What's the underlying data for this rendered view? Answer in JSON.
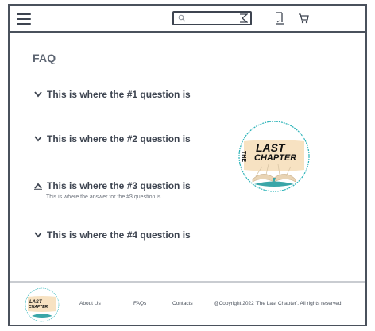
{
  "header": {
    "search": {
      "placeholder": ""
    },
    "icons": {
      "menu": "menu-icon",
      "search": "search-icon",
      "submit": "search-submit-icon",
      "account": "account-icon",
      "cart": "cart-icon"
    }
  },
  "main": {
    "title": "FAQ",
    "faqs": [
      {
        "question": "This is where the #1 question is",
        "expanded": false
      },
      {
        "question": "This is where the #2 question is",
        "expanded": false
      },
      {
        "question": "This is where the #3 question is",
        "answer": "This is where the answer for the #3 question is.",
        "expanded": true
      },
      {
        "question": "This is where the #4 question is",
        "expanded": false
      }
    ],
    "logo": {
      "line1": "THE",
      "line2": "LAST",
      "line3": "CHAPTER",
      "colors": {
        "bg": "#f7e2c2",
        "ring": "#2bb3b8",
        "ink": "#111111",
        "book": "#3aa6a8"
      }
    }
  },
  "footer": {
    "links": [
      "About Us",
      "FAQs",
      "Contacts"
    ],
    "copyright": "@Copyright 2022 'The Last Chapter'. All rights reserved."
  }
}
